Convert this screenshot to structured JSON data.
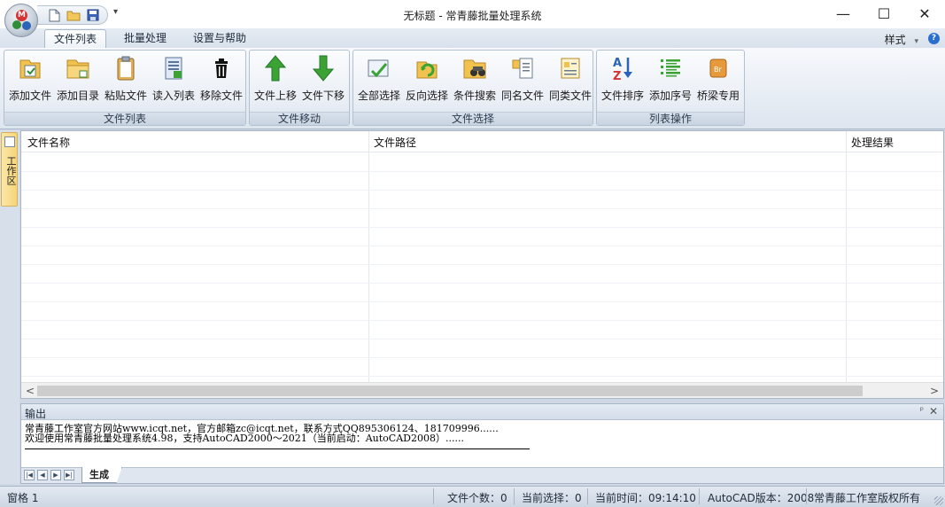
{
  "window": {
    "title": "无标题 - 常青藤批量处理系统",
    "minimize_glyph": "—",
    "maximize_glyph": "☐",
    "close_glyph": "✕"
  },
  "quick_access": {
    "more_glyph": "▾",
    "icons": [
      "new-file-icon",
      "open-folder-icon",
      "save-icon"
    ]
  },
  "tabs": [
    {
      "label": "文件列表",
      "active": true
    },
    {
      "label": "批量处理",
      "active": false
    },
    {
      "label": "设置与帮助",
      "active": false
    }
  ],
  "style_menu": {
    "label": "样式",
    "arrow": "▾",
    "help_glyph": "?"
  },
  "ribbon": {
    "groups": [
      {
        "label": "文件列表",
        "buttons": [
          {
            "label": "添加文件",
            "icon": "add-file-icon"
          },
          {
            "label": "添加目录",
            "icon": "add-folder-icon"
          },
          {
            "label": "粘贴文件",
            "icon": "paste-icon"
          },
          {
            "label": "读入列表",
            "icon": "load-list-icon"
          },
          {
            "label": "移除文件",
            "icon": "trash-icon"
          }
        ]
      },
      {
        "label": "文件移动",
        "buttons": [
          {
            "label": "文件上移",
            "icon": "arrow-up-icon"
          },
          {
            "label": "文件下移",
            "icon": "arrow-down-icon"
          }
        ]
      },
      {
        "label": "文件选择",
        "buttons": [
          {
            "label": "全部选择",
            "icon": "select-all-icon"
          },
          {
            "label": "反向选择",
            "icon": "invert-select-icon"
          },
          {
            "label": "条件搜索",
            "icon": "binoculars-icon"
          },
          {
            "label": "同名文件",
            "icon": "same-name-icon"
          },
          {
            "label": "同类文件",
            "icon": "same-type-icon"
          }
        ]
      },
      {
        "label": "列表操作",
        "buttons": [
          {
            "label": "文件排序",
            "icon": "sort-az-icon"
          },
          {
            "label": "添加序号",
            "icon": "numbered-list-icon"
          },
          {
            "label": "桥梁专用",
            "icon": "bridge-icon"
          }
        ]
      }
    ]
  },
  "dock": {
    "tab_label": "工作区"
  },
  "grid": {
    "columns": [
      "文件名称",
      "文件路径",
      "处理结果"
    ],
    "rows": [],
    "scroll_left": "<",
    "scroll_right": ">"
  },
  "output": {
    "title": "输出",
    "pin_glyph": "ᵖ",
    "close_glyph": "✕",
    "lines": [
      "常青藤工作室官方网站www.icqt.net，官方邮箱zc@icqt.net，联系方式QQ895306124、181709996......",
      "欢迎使用常青藤批量处理系统4.98，支持AutoCAD2000～2021（当前启动：AutoCAD2008）......"
    ],
    "sheet_tab": "生成",
    "nav": [
      "|◀",
      "◀",
      "▶",
      "▶|"
    ]
  },
  "status": {
    "left": "窗格 1",
    "file_count": "文件个数：0",
    "current_selection": "当前选择：0",
    "current_time": "当前时间：09:14:10",
    "autocad_version": "AutoCAD版本：2008",
    "copyright": "常青藤工作室版权所有"
  },
  "colors": {
    "ribbon_bg": "#dde5ef",
    "accent_green": "#3aa334",
    "accent_blue": "#2a6fd0",
    "dock_tab": "#f6d57a"
  }
}
